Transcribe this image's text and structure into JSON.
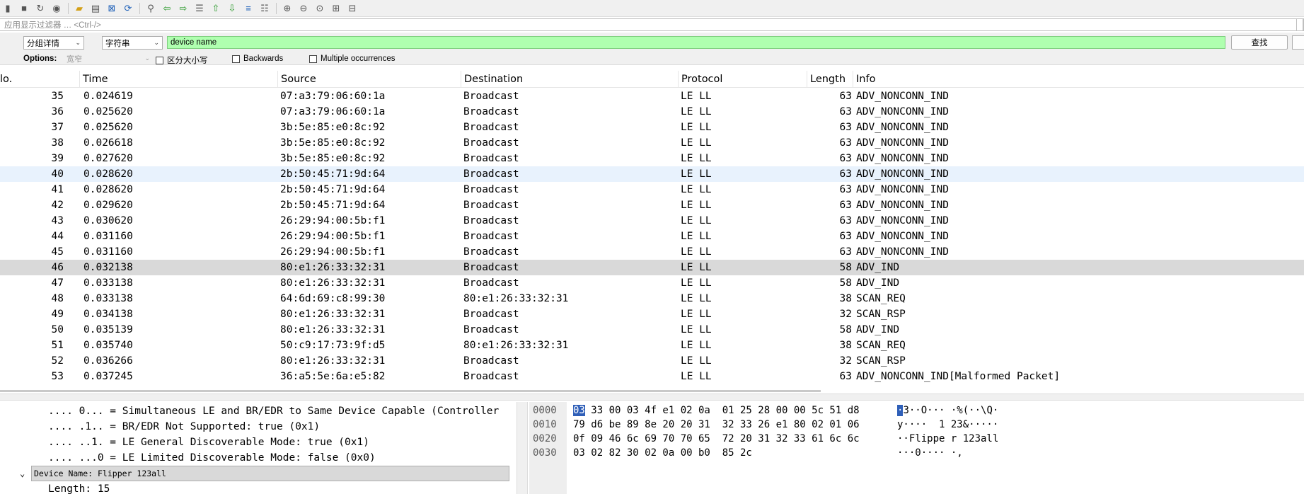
{
  "toolbar": {
    "icons": [
      "start-capture",
      "stop-capture",
      "restart-capture",
      "capture-options",
      "open-file",
      "save-file",
      "close-file",
      "reload-file",
      "find-packet",
      "go-back",
      "go-forward",
      "go-to-packet",
      "go-first",
      "go-last",
      "autoscroll",
      "colorize",
      "zoom-in",
      "zoom-out",
      "zoom-normal",
      "resize-columns",
      "resize-layout"
    ]
  },
  "display_filter": {
    "placeholder": "应用显示过滤器 … <Ctrl-/>"
  },
  "find": {
    "search_in": "分组详情",
    "search_type": "字符串",
    "value": "device name",
    "button_label": "查找",
    "options_label": "Options:",
    "charset": "宽窄",
    "case_label": "区分大小写",
    "backwards_label": "Backwards",
    "multiple_label": "Multiple occurrences"
  },
  "columns": {
    "no": "lo.",
    "time": "Time",
    "source": "Source",
    "destination": "Destination",
    "protocol": "Protocol",
    "length": "Length",
    "info": "Info"
  },
  "packets": [
    {
      "no": "35",
      "time": "0.024619",
      "source": "07:a3:79:06:60:1a",
      "destination": "Broadcast",
      "protocol": "LE LL",
      "length": "63",
      "info": "ADV_NONCONN_IND"
    },
    {
      "no": "36",
      "time": "0.025620",
      "source": "07:a3:79:06:60:1a",
      "destination": "Broadcast",
      "protocol": "LE LL",
      "length": "63",
      "info": "ADV_NONCONN_IND"
    },
    {
      "no": "37",
      "time": "0.025620",
      "source": "3b:5e:85:e0:8c:92",
      "destination": "Broadcast",
      "protocol": "LE LL",
      "length": "63",
      "info": "ADV_NONCONN_IND"
    },
    {
      "no": "38",
      "time": "0.026618",
      "source": "3b:5e:85:e0:8c:92",
      "destination": "Broadcast",
      "protocol": "LE LL",
      "length": "63",
      "info": "ADV_NONCONN_IND"
    },
    {
      "no": "39",
      "time": "0.027620",
      "source": "3b:5e:85:e0:8c:92",
      "destination": "Broadcast",
      "protocol": "LE LL",
      "length": "63",
      "info": "ADV_NONCONN_IND"
    },
    {
      "no": "40",
      "time": "0.028620",
      "source": "2b:50:45:71:9d:64",
      "destination": "Broadcast",
      "protocol": "LE LL",
      "length": "63",
      "info": "ADV_NONCONN_IND"
    },
    {
      "no": "41",
      "time": "0.028620",
      "source": "2b:50:45:71:9d:64",
      "destination": "Broadcast",
      "protocol": "LE LL",
      "length": "63",
      "info": "ADV_NONCONN_IND"
    },
    {
      "no": "42",
      "time": "0.029620",
      "source": "2b:50:45:71:9d:64",
      "destination": "Broadcast",
      "protocol": "LE LL",
      "length": "63",
      "info": "ADV_NONCONN_IND"
    },
    {
      "no": "43",
      "time": "0.030620",
      "source": "26:29:94:00:5b:f1",
      "destination": "Broadcast",
      "protocol": "LE LL",
      "length": "63",
      "info": "ADV_NONCONN_IND"
    },
    {
      "no": "44",
      "time": "0.031160",
      "source": "26:29:94:00:5b:f1",
      "destination": "Broadcast",
      "protocol": "LE LL",
      "length": "63",
      "info": "ADV_NONCONN_IND"
    },
    {
      "no": "45",
      "time": "0.031160",
      "source": "26:29:94:00:5b:f1",
      "destination": "Broadcast",
      "protocol": "LE LL",
      "length": "63",
      "info": "ADV_NONCONN_IND"
    },
    {
      "no": "46",
      "time": "0.032138",
      "source": "80:e1:26:33:32:31",
      "destination": "Broadcast",
      "protocol": "LE LL",
      "length": "58",
      "info": "ADV_IND"
    },
    {
      "no": "47",
      "time": "0.033138",
      "source": "80:e1:26:33:32:31",
      "destination": "Broadcast",
      "protocol": "LE LL",
      "length": "58",
      "info": "ADV_IND"
    },
    {
      "no": "48",
      "time": "0.033138",
      "source": "64:6d:69:c8:99:30",
      "destination": "80:e1:26:33:32:31",
      "protocol": "LE LL",
      "length": "38",
      "info": "SCAN_REQ"
    },
    {
      "no": "49",
      "time": "0.034138",
      "source": "80:e1:26:33:32:31",
      "destination": "Broadcast",
      "protocol": "LE LL",
      "length": "32",
      "info": "SCAN_RSP"
    },
    {
      "no": "50",
      "time": "0.035139",
      "source": "80:e1:26:33:32:31",
      "destination": "Broadcast",
      "protocol": "LE LL",
      "length": "58",
      "info": "ADV_IND"
    },
    {
      "no": "51",
      "time": "0.035740",
      "source": "50:c9:17:73:9f:d5",
      "destination": "80:e1:26:33:32:31",
      "protocol": "LE LL",
      "length": "38",
      "info": "SCAN_REQ"
    },
    {
      "no": "52",
      "time": "0.036266",
      "source": "80:e1:26:33:32:31",
      "destination": "Broadcast",
      "protocol": "LE LL",
      "length": "32",
      "info": "SCAN_RSP"
    },
    {
      "no": "53",
      "time": "0.037245",
      "source": "36:a5:5e:6a:e5:82",
      "destination": "Broadcast",
      "protocol": "LE LL",
      "length": "63",
      "info": "ADV_NONCONN_IND[Malformed Packet]"
    }
  ],
  "details": [
    ".... 0... = Simultaneous LE and BR/EDR to Same Device Capable (Controller",
    ".... .1.. = BR/EDR Not Supported: true (0x1)",
    ".... ..1. = LE General Discoverable Mode: true (0x1)",
    ".... ...0 = LE Limited Discoverable Mode: false (0x0)",
    "Device Name: Flipper 123all",
    "Length: 15"
  ],
  "bytes": {
    "offsets": [
      "0000",
      "0010",
      "0020",
      "0030"
    ],
    "row0_first": "03",
    "row0_rest": " 33 00 03 4f e1 02 0a  01 25 28 00 00 5c 51 d8",
    "rows": [
      "79 d6 be 89 8e 20 20 31  32 33 26 e1 80 02 01 06",
      "0f 09 46 6c 69 70 70 65  72 20 31 32 33 61 6c 6c",
      "03 02 82 30 02 0a 00 b0  85 2c"
    ],
    "ascii_first": "·",
    "ascii_row0_rest": "3··O··· ·%(··\\Q·",
    "ascii_rows": [
      "y····  1 23&·····",
      "··Flippe r 123all",
      "···0···· ·,"
    ]
  }
}
